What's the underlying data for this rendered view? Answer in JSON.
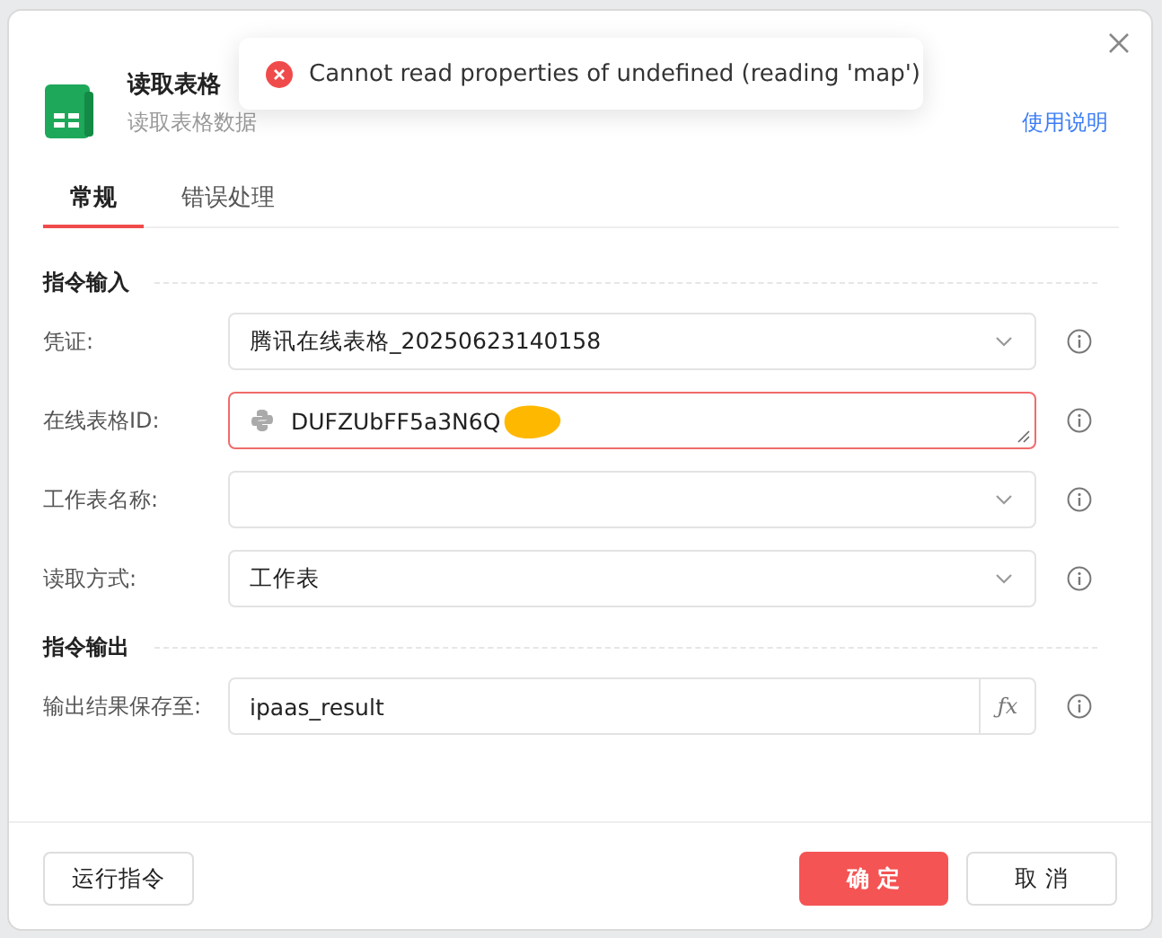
{
  "dialog": {
    "title": "读取表格",
    "subtitle": "读取表格数据",
    "help_link": "使用说明"
  },
  "toast": {
    "kind": "error",
    "message": "Cannot read properties of undefined (reading 'map')"
  },
  "tabs": [
    {
      "label": "常规",
      "selected": true
    },
    {
      "label": "错误处理",
      "selected": false
    }
  ],
  "sections": [
    {
      "title": "指令输入",
      "fields": [
        {
          "label": "凭证:",
          "kind": "select",
          "value": "腾讯在线表格_20250623140158",
          "error": false
        },
        {
          "label": "在线表格ID:",
          "kind": "textarea",
          "value": "DUFZUbFF5a3N6Q",
          "error": true,
          "redacted": true
        },
        {
          "label": "工作表名称:",
          "kind": "select",
          "error": false
        },
        {
          "label": "读取方式:",
          "kind": "select",
          "value": "工作表",
          "error": false
        }
      ]
    },
    {
      "title": "指令输出",
      "fields": [
        {
          "label": "输出结果保存至:",
          "kind": "expression",
          "value": "ipaas_result",
          "button": "ƒx",
          "error": false
        }
      ]
    }
  ],
  "footer": {
    "run_button": "运行指令",
    "confirm_button": "确 定",
    "cancel_button": "取 消"
  }
}
